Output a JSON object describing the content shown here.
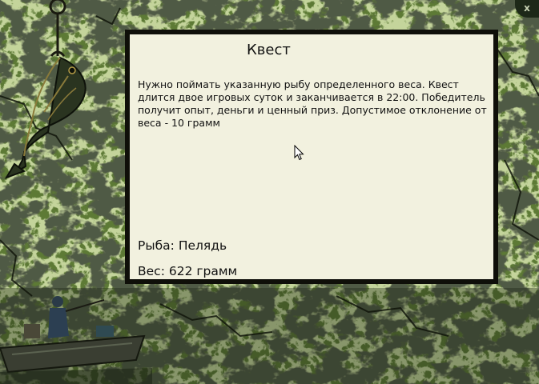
{
  "window": {
    "close_label": "x"
  },
  "quest": {
    "title": "Квест",
    "description": "Нужно поймать указанную рыбу определенного веса. Квест длится двое игровых суток и заканчивается в 22:00. Победитель получит опыт, деньги и ценный приз. Допустимое отклонение от веса - 10 грамм",
    "fish_label": "Рыба:",
    "fish_value": "Пелядь",
    "weight_label": "Вес:",
    "weight_value": "622 грамм"
  },
  "colors": {
    "background_green": "#5d7a35",
    "crack_dark": "#141a0f",
    "dialog_border": "#0f0f09",
    "dialog_fill": "#f2f1df"
  },
  "icons": {
    "fish_emblem": "fish-emblem-icon",
    "close": "close-icon",
    "cursor": "mouse-cursor-icon"
  }
}
